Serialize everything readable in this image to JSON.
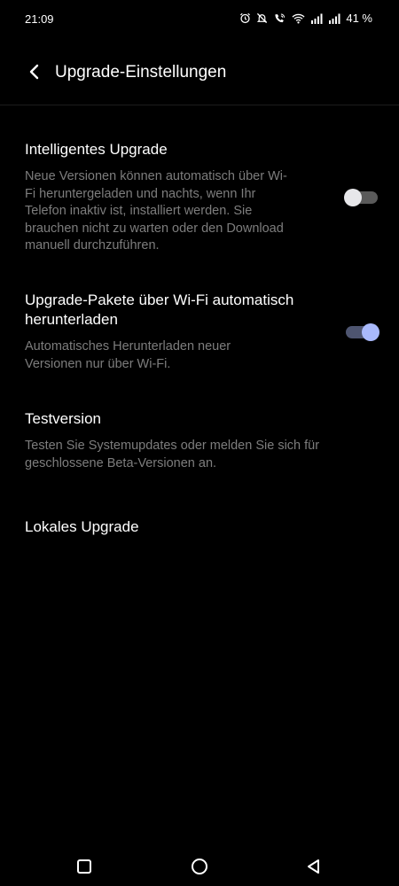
{
  "status_bar": {
    "time": "21:09",
    "battery": "41 %",
    "icons": [
      "alarm-icon",
      "mute-icon",
      "wifi-call-icon",
      "wifi-icon",
      "signal-icon",
      "signal-icon"
    ]
  },
  "header": {
    "back_icon": "chevron-left-icon",
    "title": "Upgrade-Einstellungen"
  },
  "settings": [
    {
      "title": "Intelligentes Upgrade",
      "description": "Neue Versionen können automatisch über Wi-Fi heruntergeladen und nachts, wenn Ihr Telefon inaktiv ist, installiert werden. Sie brauchen nicht zu warten oder den Download manuell durchzuführen.",
      "toggle": false
    },
    {
      "title": "Upgrade-Pakete über Wi-Fi automatisch herunterladen",
      "description": "Automatisches Herunterladen neuer Versionen nur über Wi-Fi.",
      "toggle": true
    },
    {
      "title": "Testversion",
      "description": "Testen Sie Systemupdates oder melden Sie sich für geschlossene Beta-Versionen an."
    },
    {
      "title": "Lokales Upgrade"
    }
  ],
  "nav_bar": {
    "icons": [
      "recents-square-icon",
      "home-circle-icon",
      "back-triangle-icon"
    ]
  },
  "colors": {
    "background": "#000000",
    "accent": "#a9b9fb",
    "secondary_text": "#7d7d7d"
  }
}
